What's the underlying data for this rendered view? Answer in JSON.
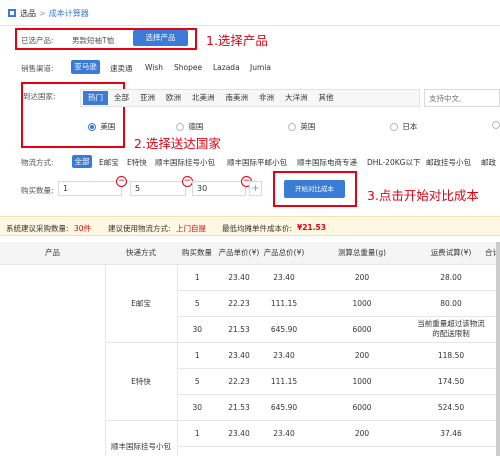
{
  "breadcrumb": {
    "root": "选品",
    "sep": ">",
    "current": "成本计算器"
  },
  "product": {
    "label": "已选产品:",
    "value": "男款短袖T恤",
    "button": "选择产品"
  },
  "channel": {
    "label": "销售渠道:",
    "options": [
      "亚马逊",
      "速卖通",
      "Wish",
      "Shopee",
      "Lazada",
      "Jumia"
    ],
    "active_index": 0
  },
  "country": {
    "label": "到达国家:",
    "tabs": [
      "热门",
      "全部",
      "亚洲",
      "欧洲",
      "北美洲",
      "南美洲",
      "非洲",
      "大洋洲",
      "其他"
    ],
    "active_tab": 0,
    "search_placeholder": "支持中文,",
    "radios": [
      "美国",
      "德国",
      "英国",
      "日本"
    ],
    "selected": 0
  },
  "logistics": {
    "label": "物流方式:",
    "options": [
      "全部",
      "E邮宝",
      "E特快",
      "顺丰国际挂号小包",
      "顺丰国际平邮小包",
      "顺丰国际电商专递",
      "DHL-20KG以下",
      "邮政挂号小包",
      "邮政"
    ]
  },
  "purchase": {
    "label": "购买数量:",
    "quantities": [
      "1",
      "5",
      "30"
    ],
    "plus": "+",
    "minus": "−",
    "compare_button": "开始对比成本"
  },
  "annotations": {
    "step1": "1.选择产品",
    "step2": "2.选择送达国家",
    "step3": "3.点击开始对比成本"
  },
  "summary": {
    "suggest_label": "系统建议采购数量:",
    "suggest_value": "30件",
    "logistics_label": "建议使用物流方式:",
    "logistics_value": "上门自提",
    "min_label": "最低均摊单件成本价:",
    "min_value": "¥21.53"
  },
  "table": {
    "headers": [
      "产品",
      "快递方式",
      "购买数量",
      "产品单价(¥)",
      "产品总价(¥)",
      "测算总重量(g)",
      "运费试算(¥)",
      "合计"
    ],
    "groups": [
      {
        "method": "E邮宝",
        "rows": [
          {
            "qty": "1",
            "unit": "23.40",
            "total": "23.40",
            "weight": "200",
            "freight": "28.00"
          },
          {
            "qty": "5",
            "unit": "22.23",
            "total": "111.15",
            "weight": "1000",
            "freight": "80.00"
          },
          {
            "qty": "30",
            "unit": "21.53",
            "total": "645.90",
            "weight": "6000",
            "freight": "当前重量超过该物流的配送限制"
          }
        ]
      },
      {
        "method": "E特快",
        "rows": [
          {
            "qty": "1",
            "unit": "23.40",
            "total": "23.40",
            "weight": "200",
            "freight": "118.50"
          },
          {
            "qty": "5",
            "unit": "22.23",
            "total": "111.15",
            "weight": "1000",
            "freight": "174.50"
          },
          {
            "qty": "30",
            "unit": "21.53",
            "total": "645.90",
            "weight": "6000",
            "freight": "524.50"
          }
        ]
      },
      {
        "method": "顺丰国际挂号小包",
        "rows": [
          {
            "qty": "1",
            "unit": "23.40",
            "total": "23.40",
            "weight": "200",
            "freight": "37.46"
          },
          {
            "qty": "5",
            "unit": "22.23",
            "total": "111.15",
            "weight": "1000",
            "freight": "131.30"
          }
        ]
      }
    ]
  },
  "colors": {
    "accent": "#3a7bd5",
    "annotation": "#e60012",
    "summary_bg": "#fef8e3"
  }
}
